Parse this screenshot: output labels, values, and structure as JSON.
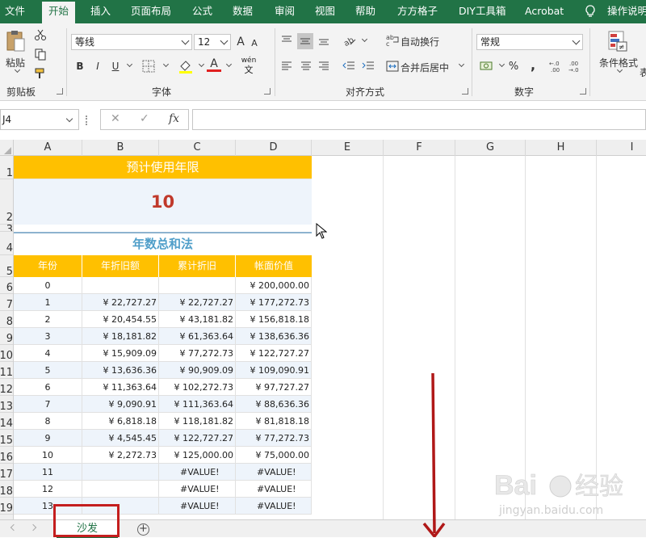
{
  "ribbon_tabs": [
    "文件",
    "开始",
    "插入",
    "页面布局",
    "公式",
    "数据",
    "审阅",
    "视图",
    "帮助",
    "方方格子",
    "DIY工具箱",
    "Acrobat",
    "操作说明"
  ],
  "active_tab": "开始",
  "clipboard": {
    "paste_label": "粘贴",
    "group_label": "剪贴板"
  },
  "font": {
    "name": "等线",
    "size": "12",
    "group_label": "字体",
    "bold": "B",
    "italic": "I",
    "underline": "U",
    "grow": "A",
    "shrink": "A",
    "wen": "wén",
    "wen_char": "文"
  },
  "alignment": {
    "wrap_label": "自动换行",
    "merge_label": "合并后居中",
    "group_label": "对齐方式"
  },
  "number": {
    "format": "常规",
    "group_label": "数字",
    "percent": "%",
    "comma": ",",
    "inc_decimal": ".0\n.00",
    "dec_decimal": ".00\n→.0"
  },
  "styles": {
    "conditional_label": "条件格式",
    "truncated_label": "表"
  },
  "formula_bar": {
    "cell_ref": "J4",
    "cancel": "✕",
    "enter": "✓",
    "fx": "fx",
    "value": ""
  },
  "columns": [
    "A",
    "B",
    "C",
    "D",
    "E",
    "F",
    "G",
    "H",
    "I"
  ],
  "rows": [
    "1",
    "2",
    "3",
    "4",
    "5",
    "6",
    "7",
    "8",
    "9",
    "10",
    "11",
    "12",
    "13",
    "14",
    "15",
    "16",
    "17",
    "18",
    "19"
  ],
  "sheet": {
    "life_title": "预计使用年限",
    "life_value": "10",
    "method_title": "年数总和法",
    "headers": [
      "年份",
      "年折旧额",
      "累计折旧",
      "帐面价值"
    ],
    "table": [
      [
        "0",
        "",
        "",
        "¥ 200,000.00"
      ],
      [
        "1",
        "¥ 22,727.27",
        "¥ 22,727.27",
        "¥ 177,272.73"
      ],
      [
        "2",
        "¥ 20,454.55",
        "¥ 43,181.82",
        "¥ 156,818.18"
      ],
      [
        "3",
        "¥ 18,181.82",
        "¥ 61,363.64",
        "¥ 138,636.36"
      ],
      [
        "4",
        "¥ 15,909.09",
        "¥ 77,272.73",
        "¥ 122,727.27"
      ],
      [
        "5",
        "¥ 13,636.36",
        "¥ 90,909.09",
        "¥ 109,090.91"
      ],
      [
        "6",
        "¥ 11,363.64",
        "¥ 102,272.73",
        "¥ 97,727.27"
      ],
      [
        "7",
        "¥ 9,090.91",
        "¥ 111,363.64",
        "¥ 88,636.36"
      ],
      [
        "8",
        "¥ 6,818.18",
        "¥ 118,181.82",
        "¥ 81,818.18"
      ],
      [
        "9",
        "¥ 4,545.45",
        "¥ 122,727.27",
        "¥ 77,272.73"
      ],
      [
        "10",
        "¥ 2,272.73",
        "¥ 125,000.00",
        "¥ 75,000.00"
      ],
      [
        "11",
        "",
        "#VALUE!",
        "#VALUE!"
      ],
      [
        "12",
        "",
        "#VALUE!",
        "#VALUE!"
      ],
      [
        "13",
        "",
        "#VALUE!",
        "#VALUE!"
      ]
    ]
  },
  "sheet_tabs": {
    "active": "沙发",
    "add": "+"
  },
  "watermark": {
    "brand": "Bai",
    "brand2": "经验",
    "url": "jingyan.baidu.com"
  },
  "colors": {
    "excel_green": "#217346",
    "header_gold": "#ffc000",
    "accent_red": "#c41e1e",
    "title_blue": "#4f9ec9",
    "band_blue": "#eef4fb"
  }
}
